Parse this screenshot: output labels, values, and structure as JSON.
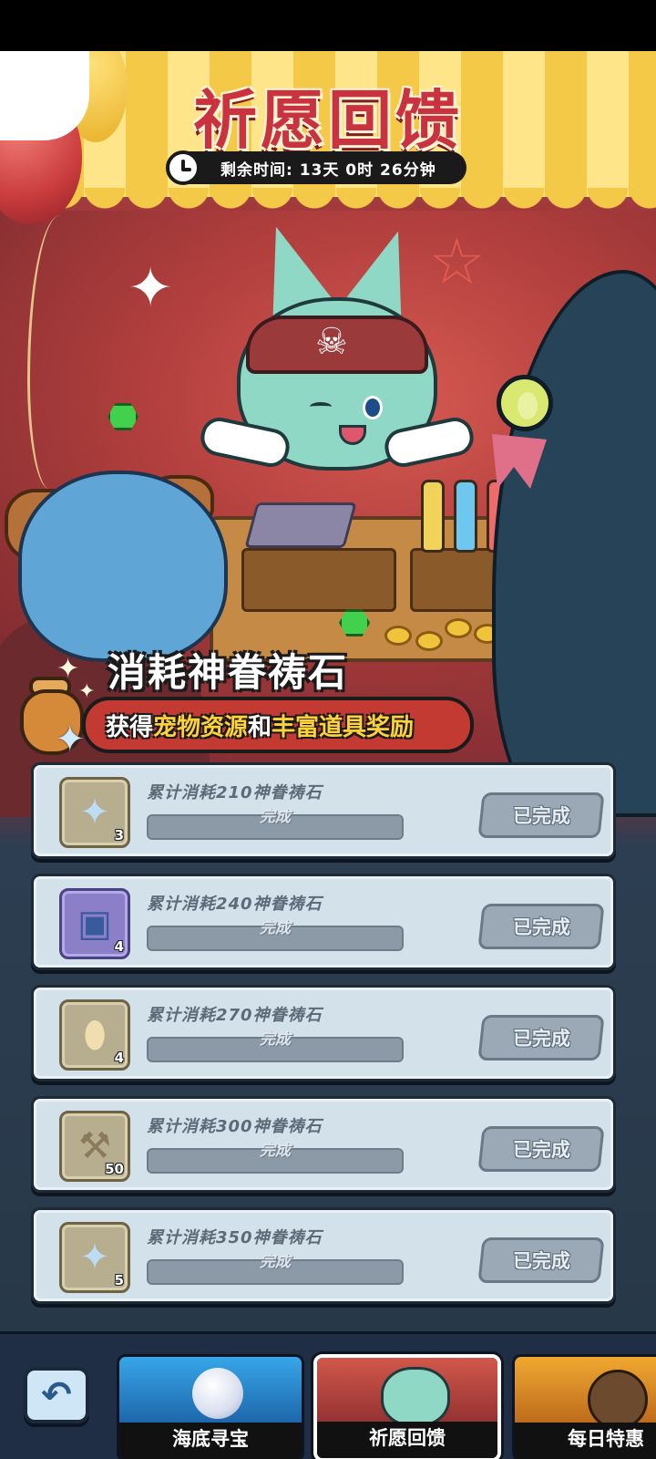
{
  "event": {
    "title": "祈愿回馈",
    "timer": "剩余时间: 13天 0时 26分钟"
  },
  "banner": {
    "title": "消耗神眷祷石",
    "subtitle_prefix": "获得",
    "subtitle_highlight1": "宠物资源",
    "subtitle_mid": "和",
    "subtitle_highlight2": "丰富道具奖励"
  },
  "tasks": [
    {
      "desc": "累计消耗210神眷祷石",
      "status": "完成",
      "button": "已完成",
      "reward_icon": "crystal-shard-icon",
      "reward_count": "3",
      "progress": 1.0
    },
    {
      "desc": "累计消耗240神眷祷石",
      "status": "完成",
      "button": "已完成",
      "reward_icon": "treasure-chest-icon",
      "reward_count": "4",
      "progress": 1.0
    },
    {
      "desc": "累计消耗270神眷祷石",
      "status": "完成",
      "button": "已完成",
      "reward_icon": "egg-icon",
      "reward_count": "4",
      "progress": 1.0
    },
    {
      "desc": "累计消耗300神眷祷石",
      "status": "完成",
      "button": "已完成",
      "reward_icon": "hammer-icon",
      "reward_count": "50",
      "progress": 1.0
    },
    {
      "desc": "累计消耗350神眷祷石",
      "status": "完成",
      "button": "已完成",
      "reward_icon": "crystal-shard-icon",
      "reward_count": "5",
      "progress": 1.0
    }
  ],
  "nav": {
    "back_icon": "back-arrow-icon",
    "tabs": [
      {
        "label": "海底寻宝",
        "active": false
      },
      {
        "label": "祈愿回馈",
        "active": true
      },
      {
        "label": "每日特惠",
        "active": false
      }
    ]
  },
  "colors": {
    "title_red": "#c9333f",
    "highlight_yellow": "#ffd23a",
    "card_bg": "#d3e1eb",
    "done_button": "#9aa9b5"
  }
}
